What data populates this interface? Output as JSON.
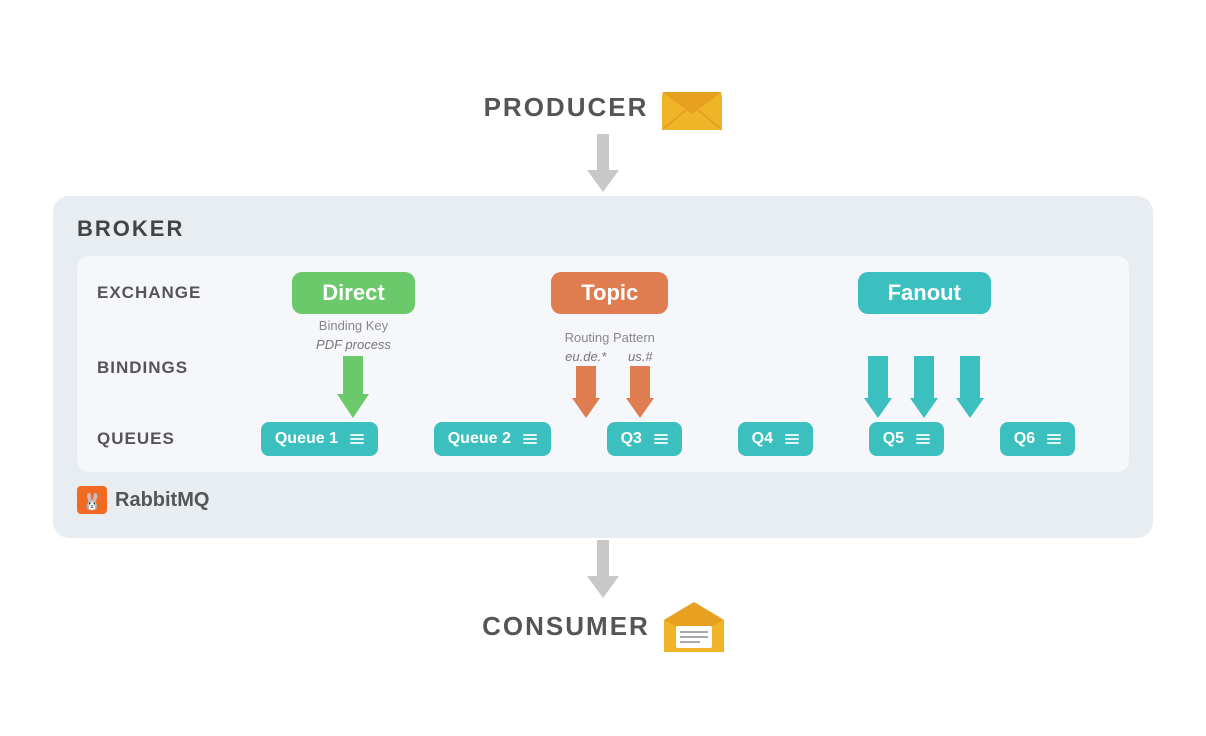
{
  "producer": {
    "label": "PRODUCER"
  },
  "consumer": {
    "label": "CONSUMER"
  },
  "broker": {
    "title": "BROKER",
    "exchange_label": "EXCHANGE",
    "bindings_label": "BINDINGS",
    "queues_label": "QUEUES",
    "rabbitmq_label": "RabbitMQ"
  },
  "exchanges": [
    {
      "id": "direct",
      "label": "Direct",
      "color": "#6bc96b"
    },
    {
      "id": "topic",
      "label": "Topic",
      "color": "#e07d50"
    },
    {
      "id": "fanout",
      "label": "Fanout",
      "color": "#3bbfbf"
    }
  ],
  "bindings": {
    "direct": {
      "key_label": "Binding Key",
      "value_label": "PDF process"
    },
    "topic": {
      "key_label": "Routing Pattern",
      "arrow1_label": "eu.de.*",
      "arrow2_label": "us.#"
    }
  },
  "queues": [
    {
      "id": "q1",
      "label": "Queue 1"
    },
    {
      "id": "q2",
      "label": "Queue 2"
    },
    {
      "id": "q3",
      "label": "Q3"
    },
    {
      "id": "q4",
      "label": "Q4"
    },
    {
      "id": "q5",
      "label": "Q5"
    },
    {
      "id": "q6",
      "label": "Q6"
    }
  ],
  "colors": {
    "direct": "#6bc96b",
    "topic": "#e07d50",
    "fanout": "#3bbfbf",
    "arrow_gray": "#c0c0c0"
  }
}
